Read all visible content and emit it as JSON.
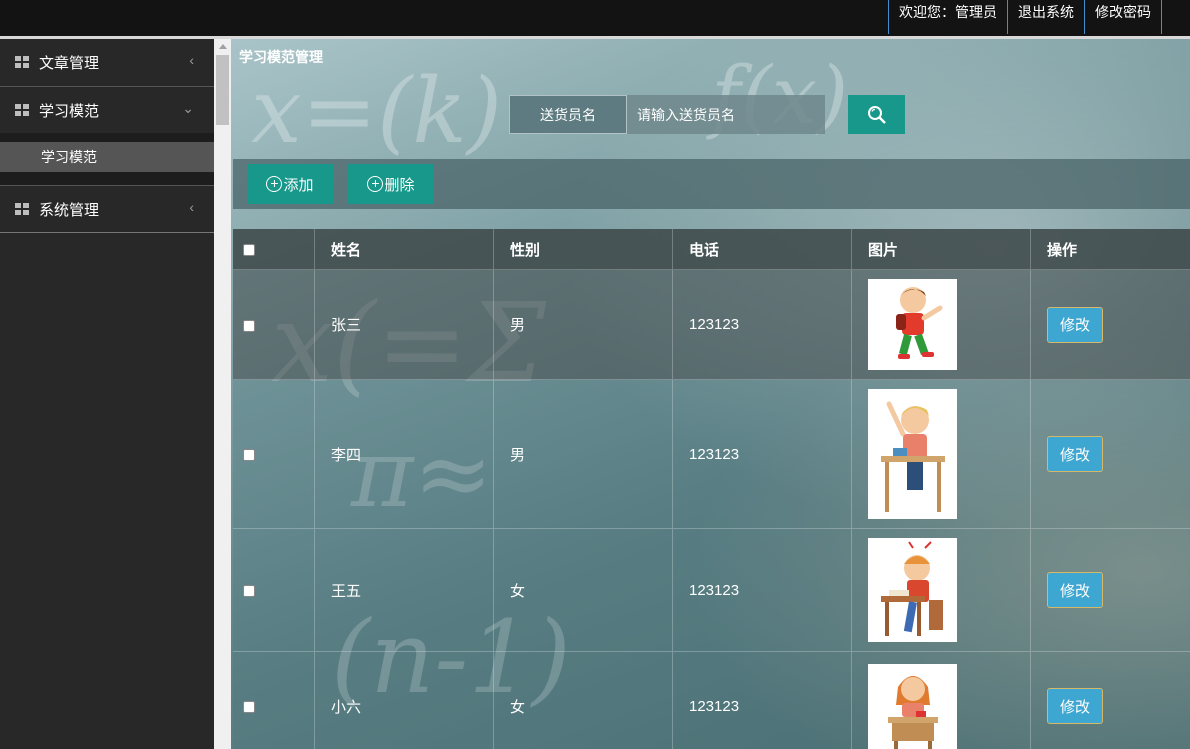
{
  "header": {
    "welcome": "欢迎您：管理员",
    "logout": "退出系统",
    "change_password": "修改密码"
  },
  "sidebar": {
    "items": [
      {
        "label": "文章管理",
        "icon": "grid-icon",
        "arrow": "chevron-left-icon"
      },
      {
        "label": "学习模范",
        "icon": "grid-icon",
        "arrow": "chevron-down-icon",
        "sub": [
          "学习模范"
        ]
      },
      {
        "label": "系统管理",
        "icon": "grid-icon",
        "arrow": "chevron-left-icon"
      }
    ]
  },
  "main": {
    "title": "学习模范管理",
    "search": {
      "label": "送货员名",
      "placeholder": "请输入送货员名",
      "button_icon": "search-icon"
    },
    "toolbar": {
      "add": "添加",
      "delete": "删除"
    },
    "table": {
      "headers": [
        "姓名",
        "性别",
        "电话",
        "图片",
        "操作"
      ],
      "rows": [
        {
          "name": "张三",
          "gender": "男",
          "phone": "123123",
          "image": "boy-running",
          "action": "修改"
        },
        {
          "name": "李四",
          "gender": "男",
          "phone": "123123",
          "image": "boy-at-desk",
          "action": "修改"
        },
        {
          "name": "王五",
          "gender": "女",
          "phone": "123123",
          "image": "boy-studying",
          "action": "修改"
        },
        {
          "name": "小六",
          "gender": "女",
          "phone": "123123",
          "image": "girl-at-desk",
          "action": "修改"
        }
      ]
    }
  },
  "colors": {
    "accent": "#17988a",
    "edit_button": "#3ea7d1",
    "topbar": "#131313",
    "sidebar": "#282828"
  }
}
